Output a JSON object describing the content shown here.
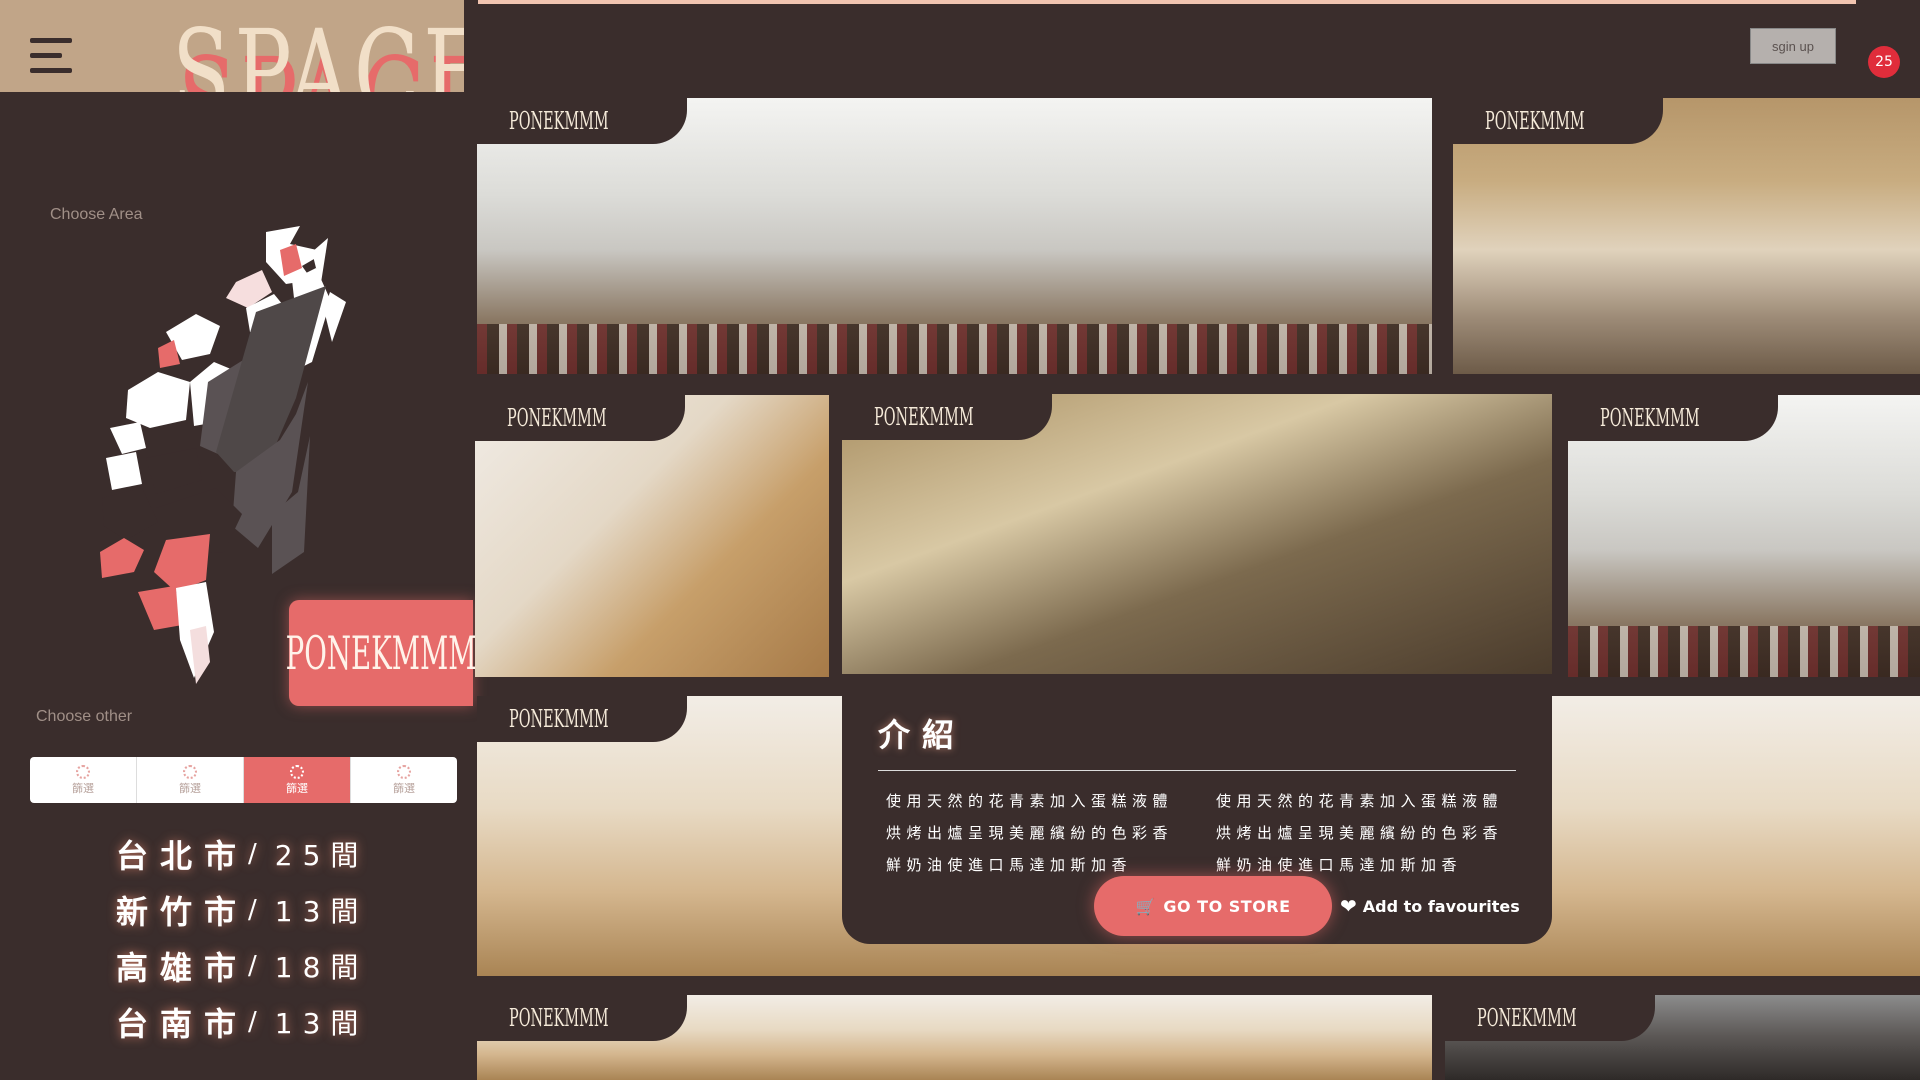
{
  "header": {
    "logo_text": "SPACE",
    "signup_label": "sgin up",
    "cart_count": "25"
  },
  "sidebar": {
    "choose_area_label": "Choose Area",
    "choose_other_label": "Choose other",
    "selected_area": "PONEKMMM",
    "filters": [
      {
        "label": "篩選",
        "active": false
      },
      {
        "label": "篩選",
        "active": false
      },
      {
        "label": "篩選",
        "active": true
      },
      {
        "label": "篩選",
        "active": false
      }
    ],
    "cities": [
      {
        "name": "台北市",
        "slash": "/",
        "count": "25間"
      },
      {
        "name": "新竹市",
        "slash": "/",
        "count": "13間"
      },
      {
        "name": "高雄市",
        "slash": "/",
        "count": "18間"
      },
      {
        "name": "台南市",
        "slash": "/",
        "count": "13間"
      }
    ]
  },
  "cards": [
    {
      "label": "PONEKMMM"
    },
    {
      "label": "PONEKMMM"
    },
    {
      "label": "PONEKMMM"
    },
    {
      "label": "PONEKMMM"
    },
    {
      "label": "PONEKMMM"
    },
    {
      "label": "PONEKMMM"
    },
    {
      "label": "PONEKMMM"
    },
    {
      "label": "PONEKMMM"
    }
  ],
  "info": {
    "title": "介紹",
    "col1": [
      "使用天然的花青素加入蛋糕液體",
      "烘烤出爐呈現美麗繽紛的色彩香",
      "鮮奶油使進口馬達加斯加香"
    ],
    "col2": [
      "使用天然的花青素加入蛋糕液體",
      "烘烤出爐呈現美麗繽紛的色彩香",
      "鮮奶油使進口馬達加斯加香"
    ],
    "go_store_label": "GO TO STORE",
    "favourite_label": "Add to favourites"
  },
  "colors": {
    "background": "#3a2d2c",
    "accent": "#e66b6a",
    "logo_bg": "#c1a588",
    "cart_badge": "#e02d3b"
  }
}
